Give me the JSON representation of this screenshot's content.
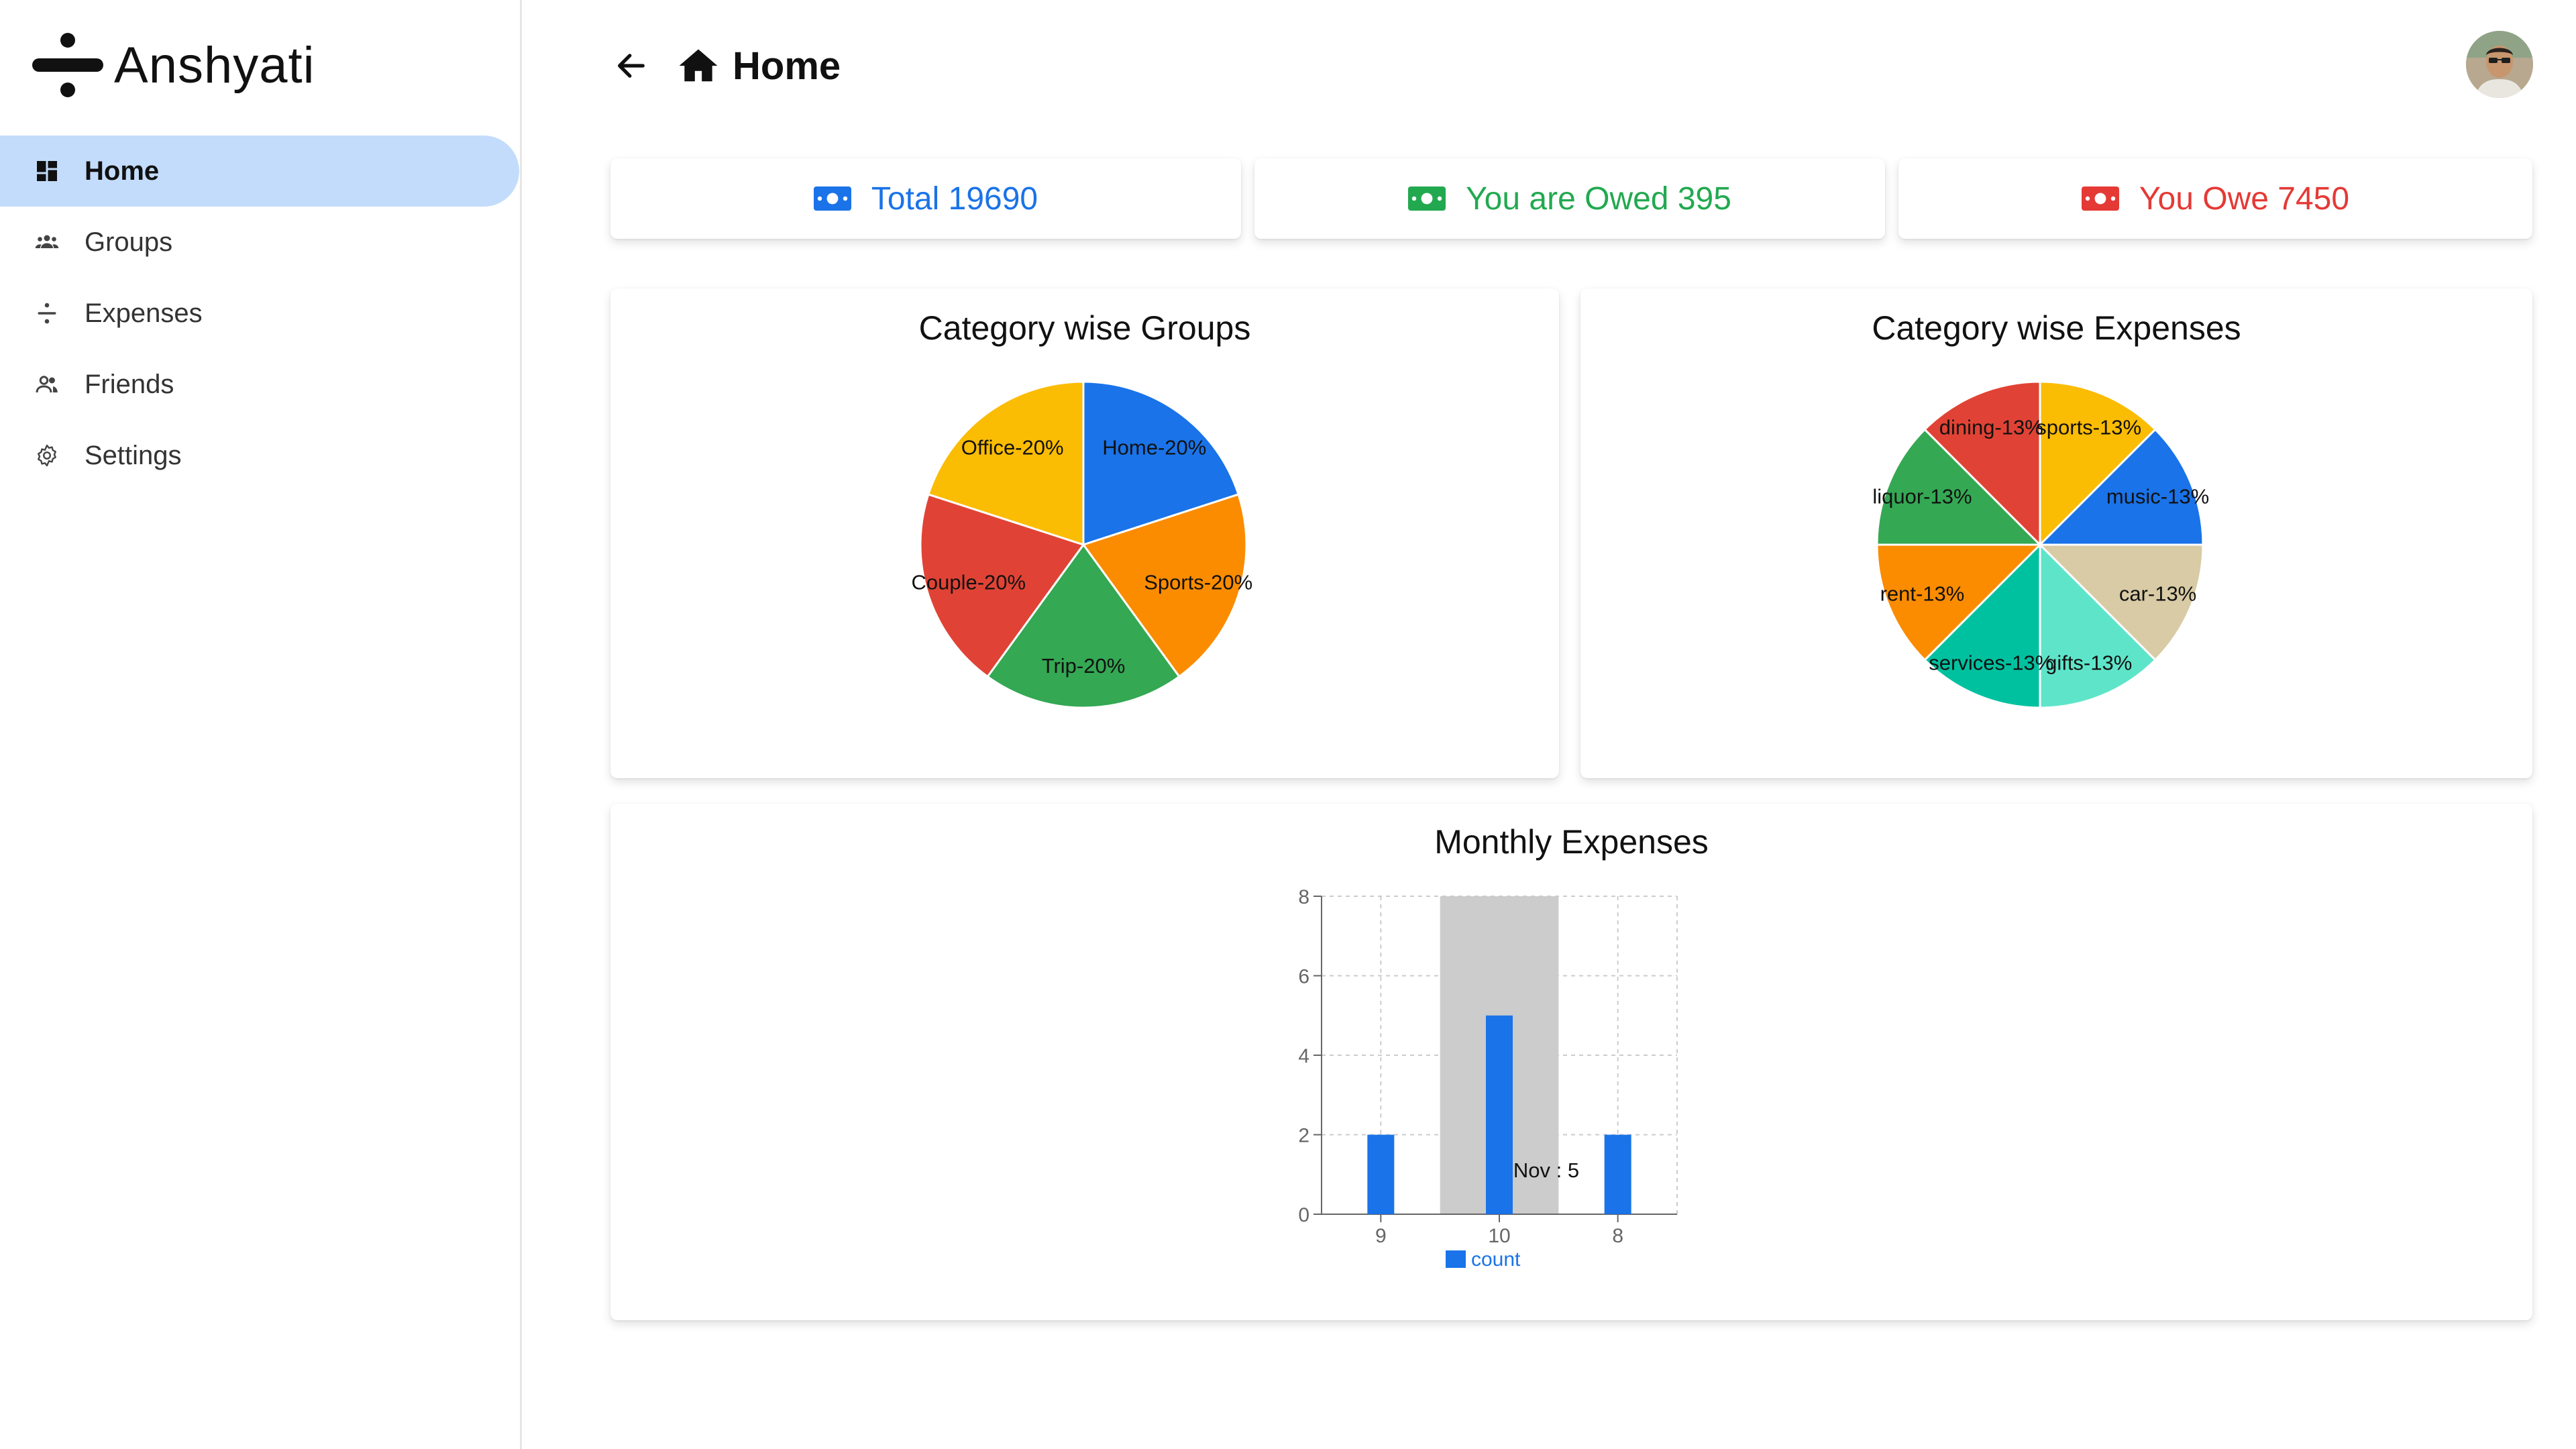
{
  "app": {
    "name": "Anshyati"
  },
  "sidebar": {
    "items": [
      {
        "label": "Home",
        "icon": "dashboard-icon",
        "active": true
      },
      {
        "label": "Groups",
        "icon": "groups-icon",
        "active": false
      },
      {
        "label": "Expenses",
        "icon": "expenses-icon",
        "active": false
      },
      {
        "label": "Friends",
        "icon": "friends-icon",
        "active": false
      },
      {
        "label": "Settings",
        "icon": "settings-icon",
        "active": false
      }
    ]
  },
  "header": {
    "title": "Home",
    "back_icon": "arrow-left-icon",
    "title_icon": "home-icon",
    "avatar": "user-avatar"
  },
  "summary": {
    "total": "Total 19690",
    "owed": "You are Owed 395",
    "owe": "You Owe 7450",
    "colors": {
      "total": "#1a73e8",
      "owed": "#22a950",
      "owe": "#e53935"
    }
  },
  "chart_data": [
    {
      "type": "pie",
      "title": "Category wise Groups",
      "slices": [
        {
          "label": "Home-20%",
          "value": 20,
          "color": "#1a73e8"
        },
        {
          "label": "Sports-20%",
          "value": 20,
          "color": "#fb8c00"
        },
        {
          "label": "Trip-20%",
          "value": 20,
          "color": "#34a853"
        },
        {
          "label": "Couple-20%",
          "value": 20,
          "color": "#e04335"
        },
        {
          "label": "Office-20%",
          "value": 20,
          "color": "#fbbc04"
        }
      ]
    },
    {
      "type": "pie",
      "title": "Category wise Expenses",
      "slices": [
        {
          "label": "sports-13%",
          "value": 12.5,
          "color": "#fbbc04"
        },
        {
          "label": "music-13%",
          "value": 12.5,
          "color": "#1a73e8"
        },
        {
          "label": "car-13%",
          "value": 12.5,
          "color": "#d8cba5"
        },
        {
          "label": "gifts-13%",
          "value": 12.5,
          "color": "#5ee5c9"
        },
        {
          "label": "services-13%",
          "value": 12.5,
          "color": "#00c19f"
        },
        {
          "label": "rent-13%",
          "value": 12.5,
          "color": "#fb8c00"
        },
        {
          "label": "liquor-13%",
          "value": 12.5,
          "color": "#34a853"
        },
        {
          "label": "dining-13%",
          "value": 12.5,
          "color": "#e04335"
        }
      ]
    },
    {
      "type": "bar",
      "title": "Monthly Expenses",
      "categories": [
        "9",
        "10",
        "8"
      ],
      "series": [
        {
          "name": "count",
          "values": [
            2,
            5,
            2
          ],
          "color": "#1a73e8"
        }
      ],
      "ylim": [
        0,
        8
      ],
      "yticks": [
        0,
        2,
        4,
        6,
        8
      ],
      "grid": true,
      "legend": "bottom",
      "tooltip": {
        "text": "Nov : 5",
        "category_index": 1
      }
    }
  ]
}
